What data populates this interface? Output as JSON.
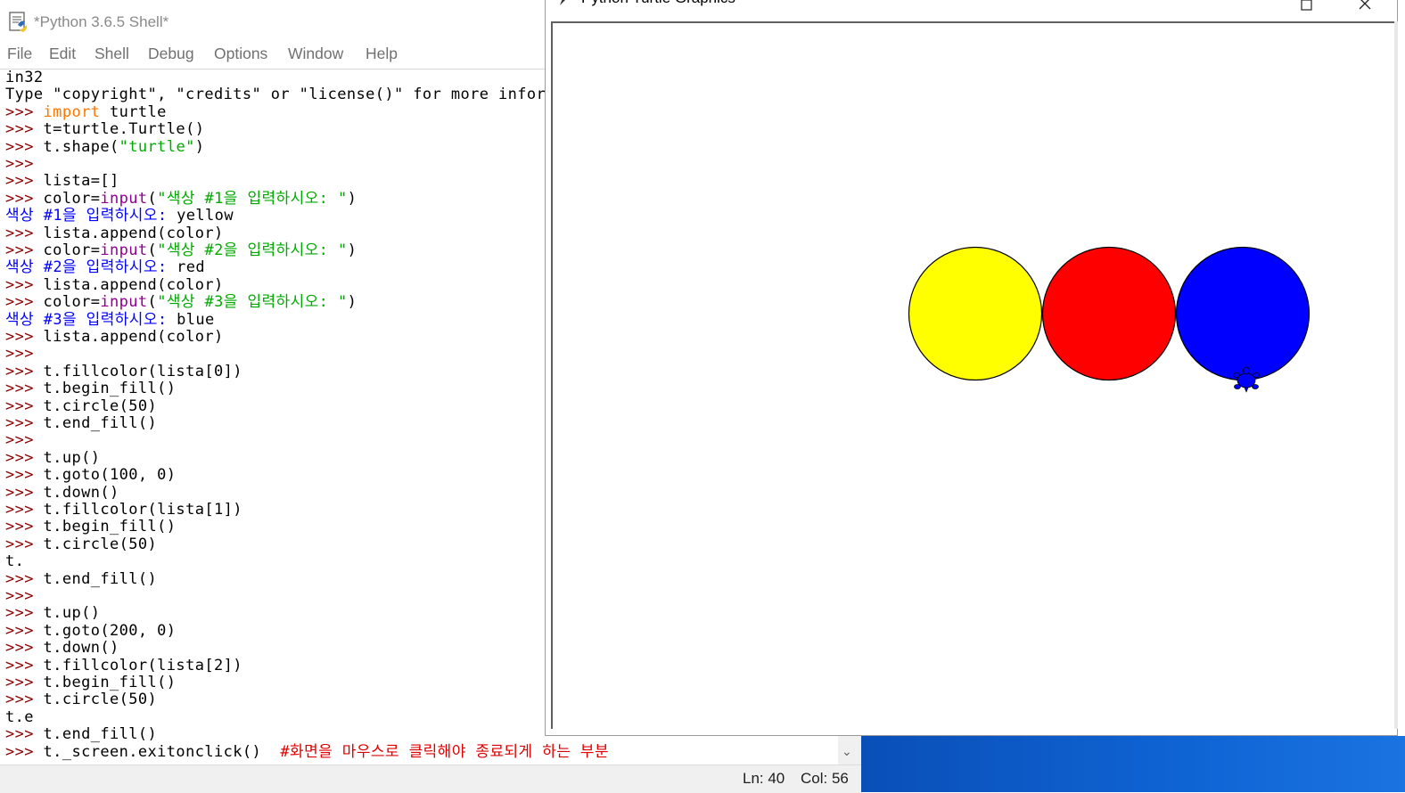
{
  "shell": {
    "title": "*Python 3.6.5 Shell*",
    "app_icon": "idle-python-icon",
    "menu": [
      "File",
      "Edit",
      "Shell",
      "Debug",
      "Options",
      "Window",
      "Help"
    ],
    "status": {
      "ln": "Ln: 40",
      "col": "Col: 56"
    },
    "lines": [
      [
        {
          "t": "in32",
          "c": "n"
        }
      ],
      [
        {
          "t": "Type \"copyright\", \"credits\" or \"license()\" for more inform",
          "c": "n"
        }
      ],
      [
        {
          "t": ">>> ",
          "c": "prompt"
        },
        {
          "t": "import",
          "c": "kw"
        },
        {
          "t": " turtle",
          "c": "n"
        }
      ],
      [
        {
          "t": ">>> ",
          "c": "prompt"
        },
        {
          "t": "t=turtle.Turtle()",
          "c": "n"
        }
      ],
      [
        {
          "t": ">>> ",
          "c": "prompt"
        },
        {
          "t": "t.shape(",
          "c": "n"
        },
        {
          "t": "\"turtle\"",
          "c": "str"
        },
        {
          "t": ")",
          "c": "n"
        }
      ],
      [
        {
          "t": ">>> ",
          "c": "prompt"
        }
      ],
      [
        {
          "t": ">>> ",
          "c": "prompt"
        },
        {
          "t": "lista=[]",
          "c": "n"
        }
      ],
      [
        {
          "t": ">>> ",
          "c": "prompt"
        },
        {
          "t": "color=",
          "c": "n"
        },
        {
          "t": "input",
          "c": "bi"
        },
        {
          "t": "(",
          "c": "n"
        },
        {
          "t": "\"색상 #1을 입력하시오: \"",
          "c": "str"
        },
        {
          "t": ")",
          "c": "n"
        }
      ],
      [
        {
          "t": "색상 #1을 입력하시오: ",
          "c": "out"
        },
        {
          "t": "yellow",
          "c": "n"
        }
      ],
      [
        {
          "t": ">>> ",
          "c": "prompt"
        },
        {
          "t": "lista.append(color)",
          "c": "n"
        }
      ],
      [
        {
          "t": ">>> ",
          "c": "prompt"
        },
        {
          "t": "color=",
          "c": "n"
        },
        {
          "t": "input",
          "c": "bi"
        },
        {
          "t": "(",
          "c": "n"
        },
        {
          "t": "\"색상 #2을 입력하시오: \"",
          "c": "str"
        },
        {
          "t": ")",
          "c": "n"
        }
      ],
      [
        {
          "t": "색상 #2을 입력하시오: ",
          "c": "out"
        },
        {
          "t": "red",
          "c": "n"
        }
      ],
      [
        {
          "t": ">>> ",
          "c": "prompt"
        },
        {
          "t": "lista.append(color)",
          "c": "n"
        }
      ],
      [
        {
          "t": ">>> ",
          "c": "prompt"
        },
        {
          "t": "color=",
          "c": "n"
        },
        {
          "t": "input",
          "c": "bi"
        },
        {
          "t": "(",
          "c": "n"
        },
        {
          "t": "\"색상 #3을 입력하시오: \"",
          "c": "str"
        },
        {
          "t": ")",
          "c": "n"
        }
      ],
      [
        {
          "t": "색상 #3을 입력하시오: ",
          "c": "out"
        },
        {
          "t": "blue",
          "c": "n"
        }
      ],
      [
        {
          "t": ">>> ",
          "c": "prompt"
        },
        {
          "t": "lista.append(color)",
          "c": "n"
        }
      ],
      [
        {
          "t": ">>> ",
          "c": "prompt"
        }
      ],
      [
        {
          "t": ">>> ",
          "c": "prompt"
        },
        {
          "t": "t.fillcolor(lista[0])",
          "c": "n"
        }
      ],
      [
        {
          "t": ">>> ",
          "c": "prompt"
        },
        {
          "t": "t.begin_fill()",
          "c": "n"
        }
      ],
      [
        {
          "t": ">>> ",
          "c": "prompt"
        },
        {
          "t": "t.circle(50)",
          "c": "n"
        }
      ],
      [
        {
          "t": ">>> ",
          "c": "prompt"
        },
        {
          "t": "t.end_fill()",
          "c": "n"
        }
      ],
      [
        {
          "t": ">>> ",
          "c": "prompt"
        }
      ],
      [
        {
          "t": ">>> ",
          "c": "prompt"
        },
        {
          "t": "t.up()",
          "c": "n"
        }
      ],
      [
        {
          "t": ">>> ",
          "c": "prompt"
        },
        {
          "t": "t.goto(100, 0)",
          "c": "n"
        }
      ],
      [
        {
          "t": ">>> ",
          "c": "prompt"
        },
        {
          "t": "t.down()",
          "c": "n"
        }
      ],
      [
        {
          "t": ">>> ",
          "c": "prompt"
        },
        {
          "t": "t.fillcolor(lista[1])",
          "c": "n"
        }
      ],
      [
        {
          "t": ">>> ",
          "c": "prompt"
        },
        {
          "t": "t.begin_fill()",
          "c": "n"
        }
      ],
      [
        {
          "t": ">>> ",
          "c": "prompt"
        },
        {
          "t": "t.circle(50)",
          "c": "n"
        }
      ],
      [
        {
          "t": "t.",
          "c": "n"
        }
      ],
      [
        {
          "t": ">>> ",
          "c": "prompt"
        },
        {
          "t": "t.end_fill()",
          "c": "n"
        }
      ],
      [
        {
          "t": ">>> ",
          "c": "prompt"
        }
      ],
      [
        {
          "t": ">>> ",
          "c": "prompt"
        },
        {
          "t": "t.up()",
          "c": "n"
        }
      ],
      [
        {
          "t": ">>> ",
          "c": "prompt"
        },
        {
          "t": "t.goto(200, 0)",
          "c": "n"
        }
      ],
      [
        {
          "t": ">>> ",
          "c": "prompt"
        },
        {
          "t": "t.down()",
          "c": "n"
        }
      ],
      [
        {
          "t": ">>> ",
          "c": "prompt"
        },
        {
          "t": "t.fillcolor(lista[2])",
          "c": "n"
        }
      ],
      [
        {
          "t": ">>> ",
          "c": "prompt"
        },
        {
          "t": "t.begin_fill()",
          "c": "n"
        }
      ],
      [
        {
          "t": ">>> ",
          "c": "prompt"
        },
        {
          "t": "t.circle(50)",
          "c": "n"
        }
      ],
      [
        {
          "t": "t.e",
          "c": "n"
        }
      ],
      [
        {
          "t": ">>> ",
          "c": "prompt"
        },
        {
          "t": "t.end_fill()",
          "c": "n"
        }
      ],
      [
        {
          "t": ">>> ",
          "c": "prompt"
        },
        {
          "t": "t._screen.exitonclick()  ",
          "c": "n"
        },
        {
          "t": "#화면을 마우스로 클릭해야 종료되게 하는 부분",
          "c": "cm"
        }
      ]
    ]
  },
  "turtle_window": {
    "title": "Python Turtle Graphics",
    "app_icon": "feather-icon",
    "buttons": [
      "maximize-icon",
      "close-icon"
    ],
    "circles": [
      {
        "name": "yellow-circle",
        "fill": "#ffff00"
      },
      {
        "name": "red-circle",
        "fill": "#ff0000"
      },
      {
        "name": "blue-circle",
        "fill": "#0000ff"
      }
    ],
    "turtle_cursor": {
      "name": "turtle-cursor",
      "fill": "#0000ff"
    }
  },
  "colors": {
    "prompt": "#8b0000",
    "keyword": "#ff7700",
    "string": "#00aa00",
    "builtin": "#900090",
    "output": "#0000ff",
    "comment": "#dd0000",
    "desktop": "#0f64d4"
  }
}
